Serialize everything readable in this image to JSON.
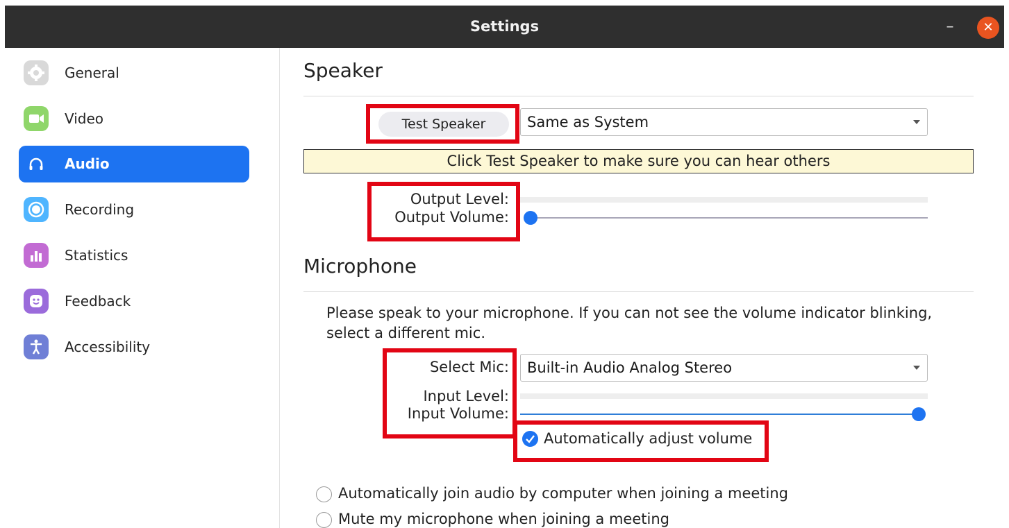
{
  "window": {
    "title": "Settings"
  },
  "sidebar": {
    "items": [
      {
        "label": "General",
        "icon": "gear-icon",
        "color": "#d6d6d6",
        "active": false
      },
      {
        "label": "Video",
        "icon": "video-camera-icon",
        "color": "#8fd66a",
        "active": false
      },
      {
        "label": "Audio",
        "icon": "headphones-icon",
        "color": "#1d73f1",
        "active": true
      },
      {
        "label": "Recording",
        "icon": "record-icon",
        "color": "#4fb5ff",
        "active": false
      },
      {
        "label": "Statistics",
        "icon": "bar-chart-icon",
        "color": "#c26bd3",
        "active": false
      },
      {
        "label": "Feedback",
        "icon": "smiley-icon",
        "color": "#9b6bdb",
        "active": false
      },
      {
        "label": "Accessibility",
        "icon": "accessibility-person-icon",
        "color": "#6f7fd6",
        "active": false
      }
    ]
  },
  "speaker": {
    "heading": "Speaker",
    "test_button": "Test Speaker",
    "device": "Same as System",
    "hint": "Click Test Speaker to make sure you can hear others",
    "output_level_label": "Output Level:",
    "output_volume_label": "Output Volume:",
    "output_level": 0,
    "output_volume": 0
  },
  "microphone": {
    "heading": "Microphone",
    "instructions": "Please speak to your microphone. If you can not see the volume indicator blinking, select a different mic.",
    "select_label": "Select Mic:",
    "device": "Built-in Audio Analog Stereo",
    "input_level_label": "Input Level:",
    "input_volume_label": "Input Volume:",
    "input_level": 0,
    "input_volume": 1,
    "auto_adjust_label": "Automatically adjust volume",
    "auto_adjust_checked": true
  },
  "options": [
    {
      "label": "Automatically join audio by computer when joining a meeting",
      "checked": false
    },
    {
      "label": "Mute my microphone when joining a meeting",
      "checked": false
    }
  ],
  "colors": {
    "accent": "#1d73f1",
    "titlebar": "#2f2f2f",
    "close_button": "#e95420",
    "annotation_red": "#e20514",
    "hint_background": "#fdf8d6"
  }
}
